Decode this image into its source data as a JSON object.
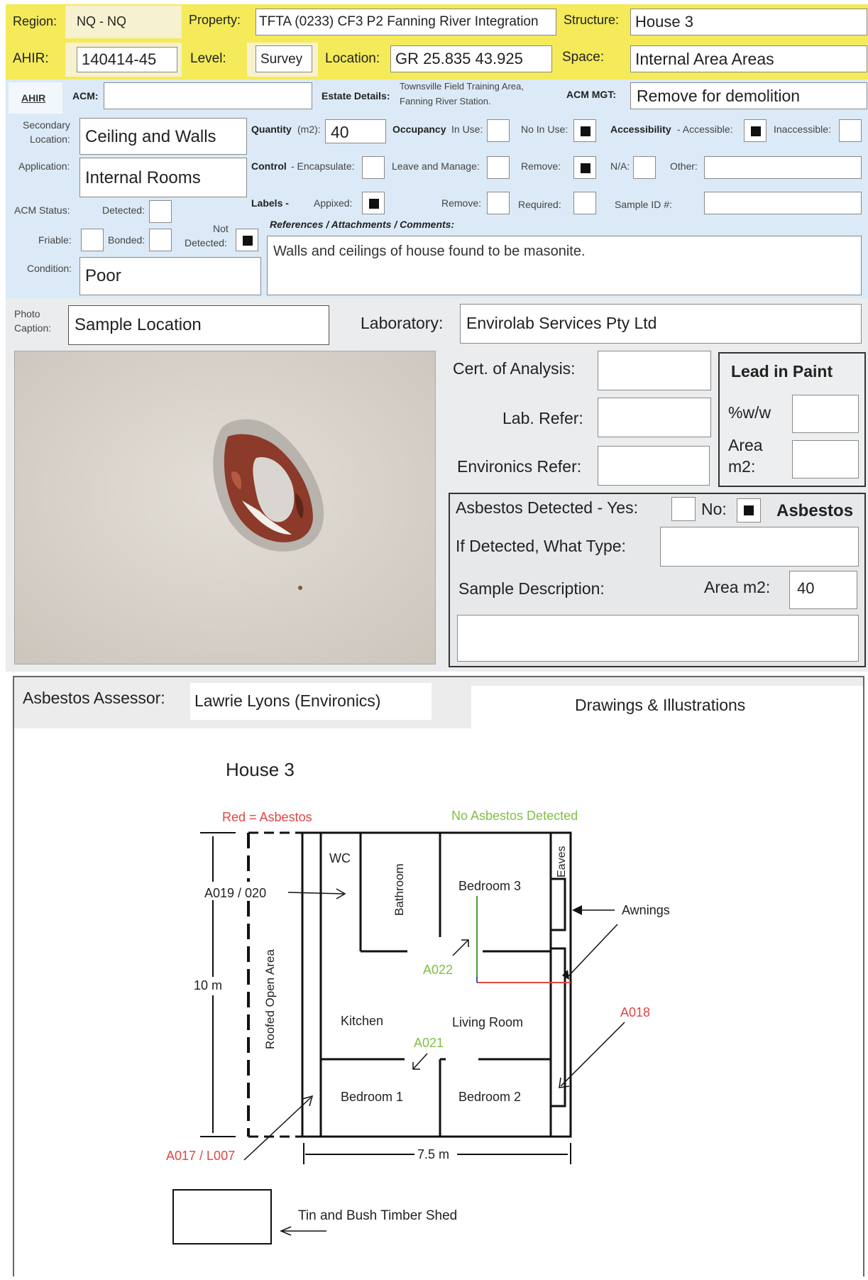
{
  "header": {
    "region_label": "Region:",
    "region_value": "NQ - NQ",
    "property_label": "Property:",
    "property_value": "TFTA (0233) CF3 P2 Fanning River Integration",
    "structure_label": "Structure:",
    "structure_value": "House 3",
    "ahir_label": "AHIR:",
    "ahir_value": "140414-45",
    "level_label": "Level:",
    "level_value": "Survey",
    "location_label": "Location:",
    "location_value": "GR 25.835  43.925",
    "space_label": "Space:",
    "space_value": "Internal Area Areas"
  },
  "acm_row": {
    "ahir_link": "AHIR",
    "acm_label": "ACM:",
    "acm_value": "",
    "estate_label": "Estate Details:",
    "estate_line1": "Townsville Field Training Area,",
    "estate_line2": "Fanning River Station.",
    "acm_mgt_label": "ACM MGT:",
    "acm_mgt_value": "Remove for demolition"
  },
  "details": {
    "secondary_location_label_1": "Secondary",
    "secondary_location_label_2": "Location:",
    "secondary_location_value": "Ceiling and Walls",
    "quantity_label": "Quantity",
    "quantity_unit": "(m2):",
    "quantity_value": "40",
    "occupancy_label": "Occupancy",
    "in_use_label": "In Use:",
    "no_in_use_label": "No In Use:",
    "accessibility_label": "Accessibility",
    "accessible_label": "-  Accessible:",
    "inaccessible_label": "Inaccessible:",
    "application_label": "Application:",
    "application_value": "Internal Rooms",
    "control_label": "Control",
    "encapsulate_label": "- Encapsulate:",
    "leave_manage_label": "Leave and Manage:",
    "remove_label": "Remove:",
    "na_label": "N/A:",
    "other_label": "Other:",
    "other_value": "",
    "acm_status_label": "ACM Status:",
    "detected_label": "Detected:",
    "labels_label": "Labels -",
    "appixed_label": "Appixed:",
    "labels_remove_label": "Remove:",
    "required_label": "Required:",
    "sample_id_label": "Sample ID #:",
    "sample_id_value": "",
    "references_label": "References / Attachments / Comments:",
    "friable_label": "Friable:",
    "bonded_label": "Bonded:",
    "not_label": "Not",
    "not_detected_label": "Detected:",
    "comments_value": "Walls and ceilings of house found to be masonite.",
    "condition_label": "Condition:",
    "condition_value": "Poor",
    "checks": {
      "in_use": false,
      "no_in_use": true,
      "accessible": true,
      "inaccessible": false,
      "encapsulate": false,
      "leave_manage": false,
      "remove": true,
      "na": false,
      "detected": false,
      "appixed": true,
      "labels_remove": false,
      "required": false,
      "friable": false,
      "bonded": false,
      "not_detected": true
    }
  },
  "photo": {
    "caption_label_1": "Photo",
    "caption_label_2": "Caption:",
    "caption_value": "Sample Location",
    "laboratory_label": "Laboratory:",
    "laboratory_value": "Envirolab Services Pty Ltd"
  },
  "lab": {
    "cert_label": "Cert. of Analysis:",
    "cert_value": "",
    "lab_refer_label": "Lab. Refer:",
    "lab_refer_value": "",
    "environics_refer_label": "Environics Refer:",
    "environics_refer_value": "",
    "lead_title": "Lead in Paint",
    "ww_label": "%w/w",
    "ww_value": "",
    "area_label_1": "Area",
    "area_label_2": "m2:",
    "area_value": ""
  },
  "asbestos": {
    "detected_label": "Asbestos Detected -  Yes:",
    "no_label": "No:",
    "badge": "Asbestos",
    "yes_checked": false,
    "no_checked": true,
    "type_label": "If Detected, What Type:",
    "type_value": "",
    "sample_desc_label": "Sample Description:",
    "area_label": "Area m2:",
    "area_value": "40",
    "desc_value": ""
  },
  "assessor": {
    "label": "Asbestos Assessor:",
    "value": "Lawrie Lyons (Environics)",
    "drawings_tab": "Drawings & Illustrations"
  },
  "drawing": {
    "title": "House 3",
    "legend_red": "Red = Asbestos",
    "legend_green": "No Asbestos Detected",
    "rooms": {
      "wc": "WC",
      "bathroom": "Bathroom",
      "bedroom3": "Bedroom 3",
      "eaves": "Eaves",
      "kitchen": "Kitchen",
      "living": "Living Room",
      "bedroom1": "Bedroom 1",
      "bedroom2": "Bedroom 2",
      "roofed": "Roofed Open Area"
    },
    "samples": {
      "a019": "A019 / 020",
      "a022": "A022",
      "a021": "A021",
      "a018": "A018",
      "a017": "A017 / L007"
    },
    "awnings": "Awnings",
    "dim_height": "10 m",
    "dim_width": "7.5 m",
    "shed": "Tin and Bush Timber Shed",
    "colors": {
      "red": "#e04545",
      "green": "#7fbf44"
    }
  }
}
